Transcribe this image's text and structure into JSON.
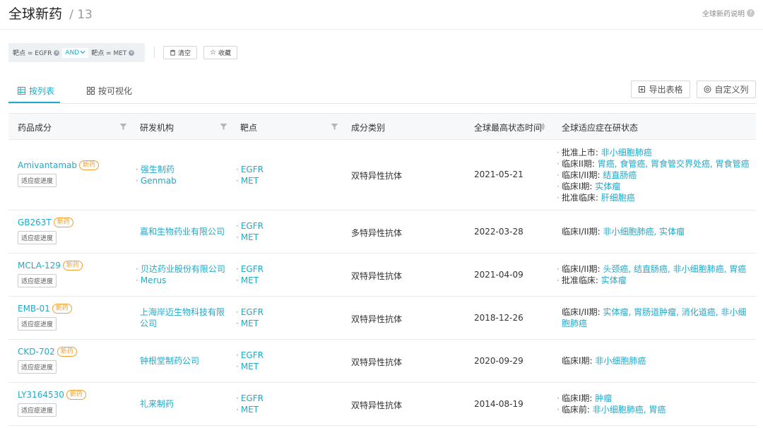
{
  "header": {
    "title": "全球新药",
    "separator": "/",
    "count": "13",
    "help_label": "全球新药说明"
  },
  "filters": {
    "chip1": "靶点 = EGFR",
    "operator": "AND",
    "chip2": "靶点 = MET",
    "clear_label": "清空",
    "save_label": "收藏"
  },
  "tabs": {
    "list_label": "按列表",
    "visual_label": "按可视化"
  },
  "toolbar": {
    "export_label": "导出表格",
    "custom_label": "自定义列"
  },
  "table": {
    "columns": {
      "drug": "药品成分",
      "org": "研发机构",
      "target": "靶点",
      "type": "成分类别",
      "date": "全球最高状态时间",
      "status": "全球适应症在研状态"
    },
    "new_tag": "新药",
    "progress_label": "适应症进度",
    "rows": [
      {
        "drug": "Amivantamab",
        "orgs": [
          "强生制药",
          "Genmab"
        ],
        "targets": [
          "EGFR",
          "MET"
        ],
        "type": "双特异性抗体",
        "date": "2021-05-21",
        "status": [
          {
            "phase": "批准上市:",
            "ind": "非小细胞肺癌"
          },
          {
            "phase": "临床II期:",
            "ind": "胃癌, 食管癌, 胃食管交界处癌, 胃食管癌"
          },
          {
            "phase": "临床I/II期:",
            "ind": "结直肠癌"
          },
          {
            "phase": "临床I期:",
            "ind": "实体瘤"
          },
          {
            "phase": "批准临床:",
            "ind": "肝细胞癌"
          }
        ]
      },
      {
        "drug": "GB263T",
        "orgs": [
          "嘉和生物药业有限公司"
        ],
        "targets": [
          "EGFR",
          "MET"
        ],
        "type": "多特异性抗体",
        "date": "2022-03-28",
        "status": [
          {
            "phase": "临床I/II期:",
            "ind": "非小细胞肺癌, 实体瘤"
          }
        ]
      },
      {
        "drug": "MCLA-129",
        "orgs": [
          "贝达药业股份有限公司",
          "Merus"
        ],
        "targets": [
          "EGFR",
          "MET"
        ],
        "type": "双特异性抗体",
        "date": "2021-04-09",
        "status": [
          {
            "phase": "临床I/II期:",
            "ind": "头颈癌, 结直肠癌, 非小细胞肺癌, 胃癌"
          },
          {
            "phase": "批准临床:",
            "ind": "实体瘤"
          }
        ]
      },
      {
        "drug": "EMB-01",
        "orgs": [
          "上海岸迈生物科技有限公司"
        ],
        "targets": [
          "EGFR",
          "MET"
        ],
        "type": "双特异性抗体",
        "date": "2018-12-26",
        "status": [
          {
            "phase": "临床I/II期:",
            "ind": "实体瘤, 胃肠道肿瘤, 消化道癌, 非小细胞肺癌"
          }
        ]
      },
      {
        "drug": "CKD-702",
        "orgs": [
          "钟根堂制药公司"
        ],
        "targets": [
          "EGFR",
          "MET"
        ],
        "type": "双特异性抗体",
        "date": "2020-09-29",
        "status": [
          {
            "phase": "临床I期:",
            "ind": "非小细胞肺癌"
          }
        ]
      },
      {
        "drug": "LY3164530",
        "orgs": [
          "礼来制药"
        ],
        "targets": [
          "EGFR",
          "MET"
        ],
        "type": "双特异性抗体",
        "date": "2014-08-19",
        "status": [
          {
            "phase": "临床I期:",
            "ind": "肿瘤"
          },
          {
            "phase": "临床前:",
            "ind": "非小细胞肺癌, 胃癌"
          }
        ]
      }
    ]
  },
  "colors": {
    "accent": "#21a9c8",
    "new_tag": "#f0a030",
    "header_bg": "#f7f8fa"
  }
}
